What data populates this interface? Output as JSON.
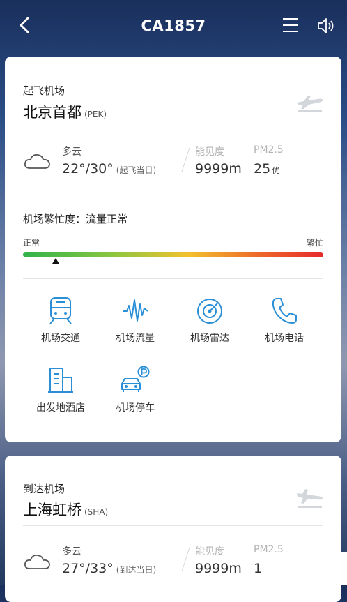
{
  "header": {
    "title": "CA1857",
    "back_icon": "chevron-left-icon",
    "menu_icon": "menu-icon",
    "speaker_icon": "speaker-icon"
  },
  "departure": {
    "section_label": "起飞机场",
    "airport_name": "北京首都",
    "airport_code": "(PEK)",
    "weather": {
      "condition": "多云",
      "temperature": "22°/30°",
      "temp_note": "(起飞当日)",
      "visibility_label": "能见度",
      "visibility_value": "9999m",
      "pm_label": "PM2.5",
      "pm_value": "25",
      "pm_quality": "优"
    },
    "congestion": {
      "title": "机场繁忙度：流量正常",
      "low_label": "正常",
      "high_label": "繁忙",
      "level": 0.11
    },
    "services": [
      {
        "label": "机场交通",
        "icon": "train-icon"
      },
      {
        "label": "机场流量",
        "icon": "pulse-wave-icon"
      },
      {
        "label": "机场雷达",
        "icon": "radar-icon"
      },
      {
        "label": "机场电话",
        "icon": "phone-icon"
      },
      {
        "label": "出发地酒店",
        "icon": "hotel-building-icon"
      },
      {
        "label": "机场停车",
        "icon": "parking-car-icon"
      }
    ]
  },
  "arrival": {
    "section_label": "到达机场",
    "airport_name": "上海虹桥",
    "airport_code": "(SHA)",
    "weather": {
      "condition": "多云",
      "temperature": "27°/33°",
      "temp_note": "(到达当日)",
      "visibility_label": "能见度",
      "visibility_value": "9999m",
      "pm_label": "PM2.5",
      "pm_value": "1"
    }
  },
  "colors": {
    "accent": "#2a8fd6",
    "bar_low": "#2fb34a",
    "bar_high": "#e62b2b"
  }
}
